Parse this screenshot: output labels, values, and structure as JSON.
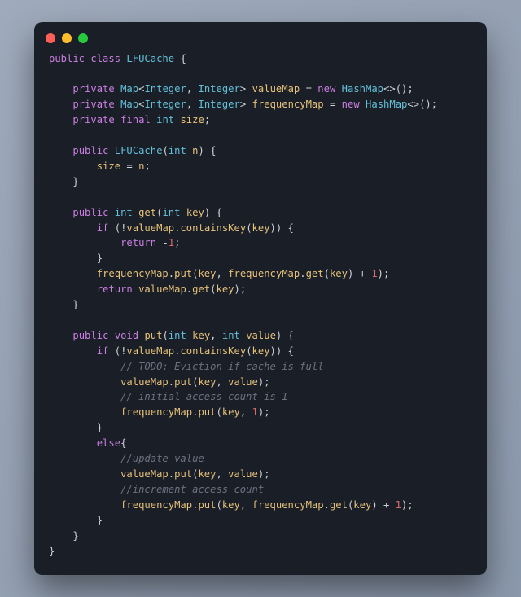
{
  "window": {
    "traffic_lights": [
      "close",
      "minimize",
      "zoom"
    ]
  },
  "code": {
    "language": "java",
    "class_name": "LFUCache",
    "tokens": [
      [
        [
          "kw",
          "public"
        ],
        [
          "sp",
          " "
        ],
        [
          "kw",
          "class"
        ],
        [
          "sp",
          " "
        ],
        [
          "type",
          "LFUCache"
        ],
        [
          "sp",
          " "
        ],
        [
          "pun",
          "{"
        ]
      ],
      [],
      [
        [
          "sp",
          "    "
        ],
        [
          "kw",
          "private"
        ],
        [
          "sp",
          " "
        ],
        [
          "type",
          "Map"
        ],
        [
          "pun",
          "<"
        ],
        [
          "type",
          "Integer"
        ],
        [
          "pun",
          ", "
        ],
        [
          "type",
          "Integer"
        ],
        [
          "pun",
          "> "
        ],
        [
          "name",
          "valueMap"
        ],
        [
          "sp",
          " "
        ],
        [
          "pun",
          "= "
        ],
        [
          "kw",
          "new"
        ],
        [
          "sp",
          " "
        ],
        [
          "type",
          "HashMap"
        ],
        [
          "pun",
          "<>();"
        ]
      ],
      [
        [
          "sp",
          "    "
        ],
        [
          "kw",
          "private"
        ],
        [
          "sp",
          " "
        ],
        [
          "type",
          "Map"
        ],
        [
          "pun",
          "<"
        ],
        [
          "type",
          "Integer"
        ],
        [
          "pun",
          ", "
        ],
        [
          "type",
          "Integer"
        ],
        [
          "pun",
          "> "
        ],
        [
          "name",
          "frequencyMap"
        ],
        [
          "sp",
          " "
        ],
        [
          "pun",
          "= "
        ],
        [
          "kw",
          "new"
        ],
        [
          "sp",
          " "
        ],
        [
          "type",
          "HashMap"
        ],
        [
          "pun",
          "<>();"
        ]
      ],
      [
        [
          "sp",
          "    "
        ],
        [
          "kw",
          "private"
        ],
        [
          "sp",
          " "
        ],
        [
          "kw",
          "final"
        ],
        [
          "sp",
          " "
        ],
        [
          "type",
          "int"
        ],
        [
          "sp",
          " "
        ],
        [
          "name",
          "size"
        ],
        [
          "pun",
          ";"
        ]
      ],
      [],
      [
        [
          "sp",
          "    "
        ],
        [
          "kw",
          "public"
        ],
        [
          "sp",
          " "
        ],
        [
          "type",
          "LFUCache"
        ],
        [
          "pun",
          "("
        ],
        [
          "type",
          "int"
        ],
        [
          "sp",
          " "
        ],
        [
          "name",
          "n"
        ],
        [
          "pun",
          ") {"
        ]
      ],
      [
        [
          "sp",
          "        "
        ],
        [
          "name",
          "size"
        ],
        [
          "sp",
          " "
        ],
        [
          "pun",
          "= "
        ],
        [
          "name",
          "n"
        ],
        [
          "pun",
          ";"
        ]
      ],
      [
        [
          "sp",
          "    "
        ],
        [
          "pun",
          "}"
        ]
      ],
      [],
      [
        [
          "sp",
          "    "
        ],
        [
          "kw",
          "public"
        ],
        [
          "sp",
          " "
        ],
        [
          "type",
          "int"
        ],
        [
          "sp",
          " "
        ],
        [
          "name",
          "get"
        ],
        [
          "pun",
          "("
        ],
        [
          "type",
          "int"
        ],
        [
          "sp",
          " "
        ],
        [
          "name",
          "key"
        ],
        [
          "pun",
          ") {"
        ]
      ],
      [
        [
          "sp",
          "        "
        ],
        [
          "kw",
          "if"
        ],
        [
          "sp",
          " "
        ],
        [
          "pun",
          "(!"
        ],
        [
          "name",
          "valueMap"
        ],
        [
          "pun",
          "."
        ],
        [
          "name",
          "containsKey"
        ],
        [
          "pun",
          "("
        ],
        [
          "name",
          "key"
        ],
        [
          "pun",
          ")) {"
        ]
      ],
      [
        [
          "sp",
          "            "
        ],
        [
          "kw",
          "return"
        ],
        [
          "sp",
          " "
        ],
        [
          "pun",
          "-"
        ],
        [
          "num",
          "1"
        ],
        [
          "pun",
          ";"
        ]
      ],
      [
        [
          "sp",
          "        "
        ],
        [
          "pun",
          "}"
        ]
      ],
      [
        [
          "sp",
          "        "
        ],
        [
          "name",
          "frequencyMap"
        ],
        [
          "pun",
          "."
        ],
        [
          "name",
          "put"
        ],
        [
          "pun",
          "("
        ],
        [
          "name",
          "key"
        ],
        [
          "pun",
          ", "
        ],
        [
          "name",
          "frequencyMap"
        ],
        [
          "pun",
          "."
        ],
        [
          "name",
          "get"
        ],
        [
          "pun",
          "("
        ],
        [
          "name",
          "key"
        ],
        [
          "pun",
          ") + "
        ],
        [
          "num",
          "1"
        ],
        [
          "pun",
          ");"
        ]
      ],
      [
        [
          "sp",
          "        "
        ],
        [
          "kw",
          "return"
        ],
        [
          "sp",
          " "
        ],
        [
          "name",
          "valueMap"
        ],
        [
          "pun",
          "."
        ],
        [
          "name",
          "get"
        ],
        [
          "pun",
          "("
        ],
        [
          "name",
          "key"
        ],
        [
          "pun",
          ");"
        ]
      ],
      [
        [
          "sp",
          "    "
        ],
        [
          "pun",
          "}"
        ]
      ],
      [],
      [
        [
          "sp",
          "    "
        ],
        [
          "kw",
          "public"
        ],
        [
          "sp",
          " "
        ],
        [
          "kw",
          "void"
        ],
        [
          "sp",
          " "
        ],
        [
          "name",
          "put"
        ],
        [
          "pun",
          "("
        ],
        [
          "type",
          "int"
        ],
        [
          "sp",
          " "
        ],
        [
          "name",
          "key"
        ],
        [
          "pun",
          ", "
        ],
        [
          "type",
          "int"
        ],
        [
          "sp",
          " "
        ],
        [
          "name",
          "value"
        ],
        [
          "pun",
          ") {"
        ]
      ],
      [
        [
          "sp",
          "        "
        ],
        [
          "kw",
          "if"
        ],
        [
          "sp",
          " "
        ],
        [
          "pun",
          "(!"
        ],
        [
          "name",
          "valueMap"
        ],
        [
          "pun",
          "."
        ],
        [
          "name",
          "containsKey"
        ],
        [
          "pun",
          "("
        ],
        [
          "name",
          "key"
        ],
        [
          "pun",
          ")) {"
        ]
      ],
      [
        [
          "sp",
          "            "
        ],
        [
          "cmt",
          "// TODO: Eviction if cache is full"
        ]
      ],
      [
        [
          "sp",
          "            "
        ],
        [
          "name",
          "valueMap"
        ],
        [
          "pun",
          "."
        ],
        [
          "name",
          "put"
        ],
        [
          "pun",
          "("
        ],
        [
          "name",
          "key"
        ],
        [
          "pun",
          ", "
        ],
        [
          "name",
          "value"
        ],
        [
          "pun",
          ");"
        ]
      ],
      [
        [
          "sp",
          "            "
        ],
        [
          "cmt",
          "// initial access count is 1"
        ]
      ],
      [
        [
          "sp",
          "            "
        ],
        [
          "name",
          "frequencyMap"
        ],
        [
          "pun",
          "."
        ],
        [
          "name",
          "put"
        ],
        [
          "pun",
          "("
        ],
        [
          "name",
          "key"
        ],
        [
          "pun",
          ", "
        ],
        [
          "num",
          "1"
        ],
        [
          "pun",
          ");"
        ]
      ],
      [
        [
          "sp",
          "        "
        ],
        [
          "pun",
          "}"
        ]
      ],
      [
        [
          "sp",
          "        "
        ],
        [
          "kw",
          "else"
        ],
        [
          "pun",
          "{"
        ]
      ],
      [
        [
          "sp",
          "            "
        ],
        [
          "cmt",
          "//update value"
        ]
      ],
      [
        [
          "sp",
          "            "
        ],
        [
          "name",
          "valueMap"
        ],
        [
          "pun",
          "."
        ],
        [
          "name",
          "put"
        ],
        [
          "pun",
          "("
        ],
        [
          "name",
          "key"
        ],
        [
          "pun",
          ", "
        ],
        [
          "name",
          "value"
        ],
        [
          "pun",
          ");"
        ]
      ],
      [
        [
          "sp",
          "            "
        ],
        [
          "cmt",
          "//increment access count"
        ]
      ],
      [
        [
          "sp",
          "            "
        ],
        [
          "name",
          "frequencyMap"
        ],
        [
          "pun",
          "."
        ],
        [
          "name",
          "put"
        ],
        [
          "pun",
          "("
        ],
        [
          "name",
          "key"
        ],
        [
          "pun",
          ", "
        ],
        [
          "name",
          "frequencyMap"
        ],
        [
          "pun",
          "."
        ],
        [
          "name",
          "get"
        ],
        [
          "pun",
          "("
        ],
        [
          "name",
          "key"
        ],
        [
          "pun",
          ") + "
        ],
        [
          "num",
          "1"
        ],
        [
          "pun",
          ");"
        ]
      ],
      [
        [
          "sp",
          "        "
        ],
        [
          "pun",
          "}"
        ]
      ],
      [
        [
          "sp",
          "    "
        ],
        [
          "pun",
          "}"
        ]
      ],
      [
        [
          "pun",
          "}"
        ]
      ]
    ]
  }
}
